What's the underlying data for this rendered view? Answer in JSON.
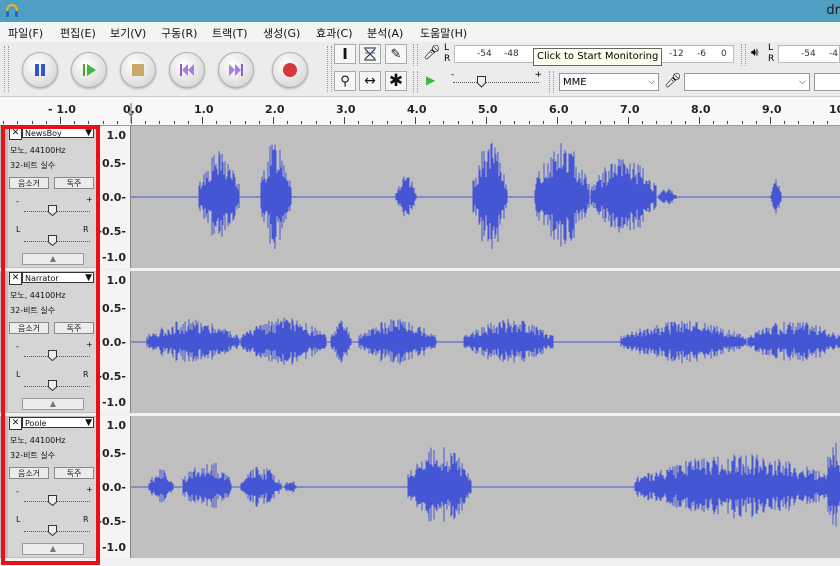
{
  "title": {
    "text": "dr"
  },
  "menu": [
    "파일(F)",
    "편집(E)",
    "보기(V)",
    "구동(R)",
    "트랙(T)",
    "생성(G)",
    "효과(C)",
    "분석(A)",
    "도움말(H)"
  ],
  "meters": {
    "record": {
      "l": "L",
      "r": "R",
      "ticks": [
        "-54",
        "-48",
        "-12",
        "-6",
        "0"
      ]
    },
    "playback": {
      "l": "L",
      "r": "R",
      "ticks": [
        "-54",
        "-4"
      ]
    },
    "tooltip": "Click to Start Monitoring"
  },
  "device": {
    "host": "MME"
  },
  "ruler": {
    "labels": [
      "- 1.0",
      "0.0",
      "1.0",
      "2.0",
      "3.0",
      "4.0",
      "5.0",
      "6.0",
      "7.0",
      "8.0",
      "9.0",
      "10"
    ]
  },
  "tracks": [
    {
      "name": "NewsBoy",
      "info1": "모노, 44100Hz",
      "info2": "32-비트 실수",
      "mute": "음소거",
      "solo": "독주",
      "gain_minus": "-",
      "gain_plus": "+",
      "pan_l": "L",
      "pan_r": "R",
      "collapse": "▲",
      "scale": [
        "1.0",
        "0.5-",
        "0.0-",
        "-0.5-",
        "-1.0"
      ]
    },
    {
      "name": "Narrator",
      "info1": "모노, 44100Hz",
      "info2": "32-비트 실수",
      "mute": "음소거",
      "solo": "독주",
      "gain_minus": "-",
      "gain_plus": "+",
      "pan_l": "L",
      "pan_r": "R",
      "collapse": "▲",
      "scale": [
        "1.0",
        "0.5-",
        "0.0-",
        "-0.5-",
        "-1.0"
      ]
    },
    {
      "name": "Poole",
      "info1": "모노, 44100Hz",
      "info2": "32-비트 실수",
      "mute": "음소거",
      "solo": "독주",
      "gain_minus": "-",
      "gain_plus": "+",
      "pan_l": "L",
      "pan_r": "R",
      "collapse": "▲",
      "scale": [
        "1.0",
        "0.5-",
        "0.0-",
        "-0.5-",
        "-1.0"
      ]
    }
  ],
  "colors": {
    "waveform": "#4556d4",
    "highlight": "#e8111a",
    "titlebar": "#4f9fc2"
  }
}
